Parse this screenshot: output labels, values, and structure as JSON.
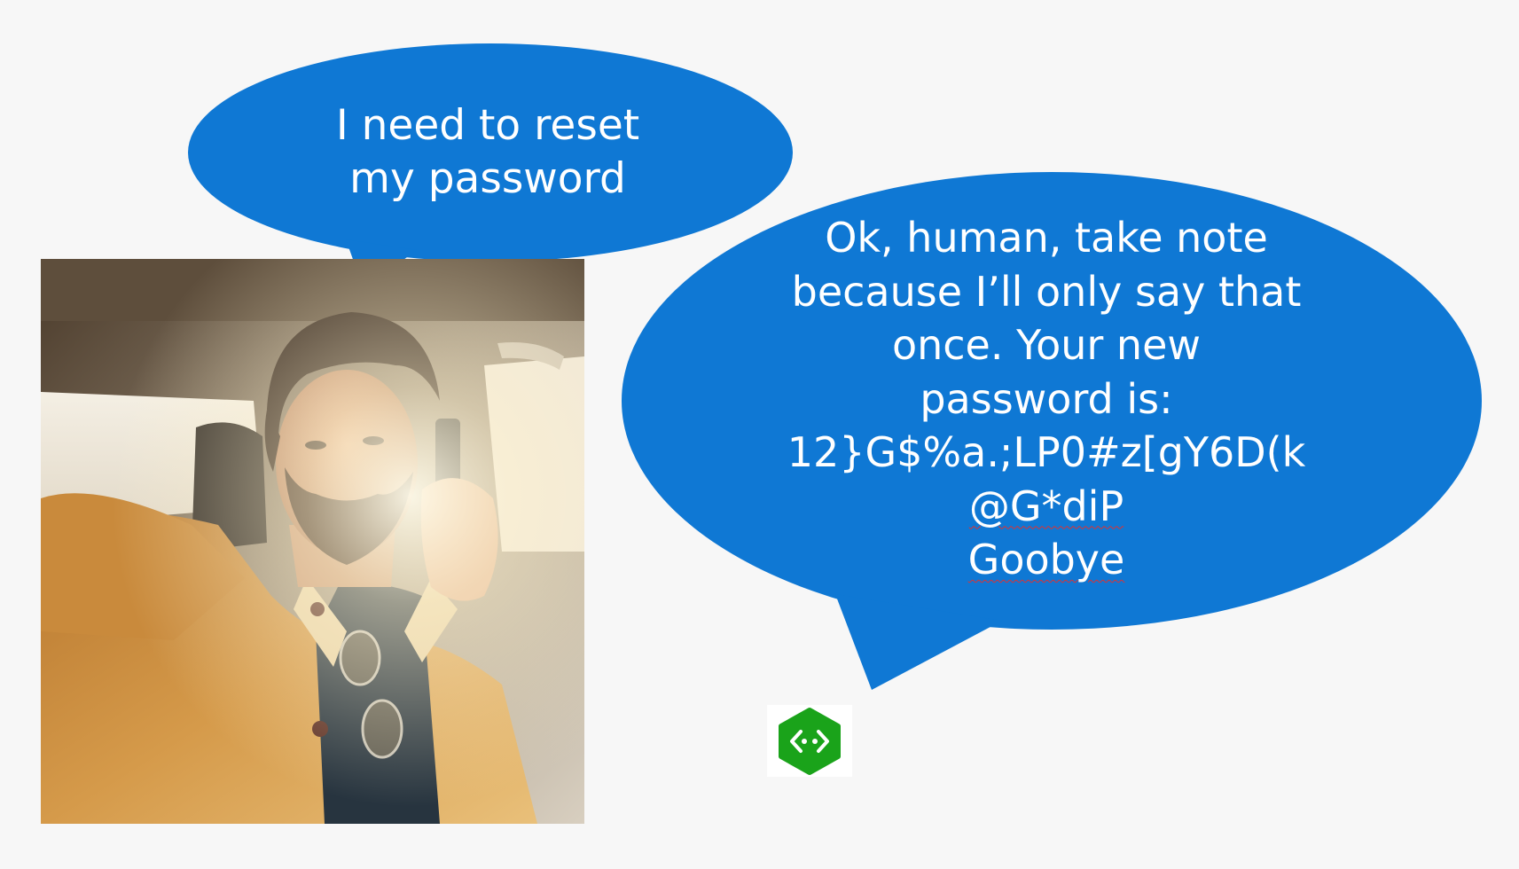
{
  "user_bubble": {
    "lines": [
      "I need to reset",
      "my password"
    ]
  },
  "bot_bubble": {
    "lines": [
      "Ok, human, take note",
      "because I’ll only say that",
      "once. Your new",
      "password is:",
      "12}G$%a.;LP0#z[gY6D(k",
      "@G*diP",
      "Goobye"
    ]
  },
  "colors": {
    "bubble_blue": "#0f78d4",
    "background": "#f7f7f7",
    "bot_icon_green": "#1aa31a",
    "spellcheck_red": "#e03030"
  },
  "icons": {
    "bot": "bot-service-icon"
  }
}
